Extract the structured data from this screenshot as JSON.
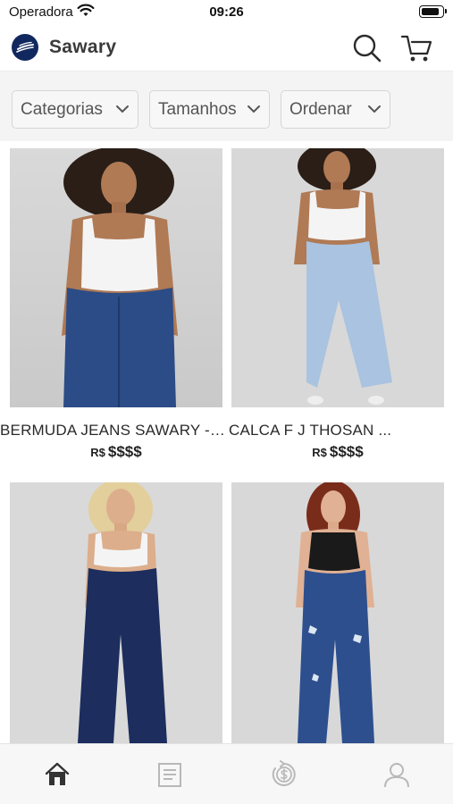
{
  "status_bar": {
    "carrier": "Operadora",
    "time": "09:26",
    "battery_level": 0.9
  },
  "header": {
    "brand_name": "Sawary",
    "icons": [
      "brand-logo-icon",
      "search-icon",
      "cart-icon"
    ]
  },
  "filters": [
    {
      "label": "Categorias"
    },
    {
      "label": "Tamanhos"
    },
    {
      "label": "Ordenar"
    }
  ],
  "products": [
    {
      "name": "BERMUDA JEANS SAWARY - ...",
      "currency": "R$",
      "price": "$$$$",
      "jeans_color": "#2b4c86",
      "top_color": "#f4f4f4"
    },
    {
      "name": "CALCA F J THOSAN ...",
      "currency": "R$",
      "price": "$$$$",
      "jeans_color": "#a9c3e0",
      "top_color": "#f4f4f4"
    },
    {
      "name": "",
      "currency": "",
      "price": "",
      "jeans_color": "#1c2d5e",
      "top_color": "#f4f4f4"
    },
    {
      "name": "",
      "currency": "",
      "price": "",
      "jeans_color": "#2d4f8e",
      "top_color": "#1a1a1a"
    }
  ],
  "tab_bar": {
    "active_tab": "home",
    "tabs": [
      {
        "id": "home",
        "icon": "home-icon"
      },
      {
        "id": "orders",
        "icon": "orders-icon"
      },
      {
        "id": "wallet",
        "icon": "wallet-icon"
      },
      {
        "id": "profile",
        "icon": "profile-icon"
      }
    ],
    "active_color": "#333333",
    "inactive_color": "#b8b8b8"
  }
}
